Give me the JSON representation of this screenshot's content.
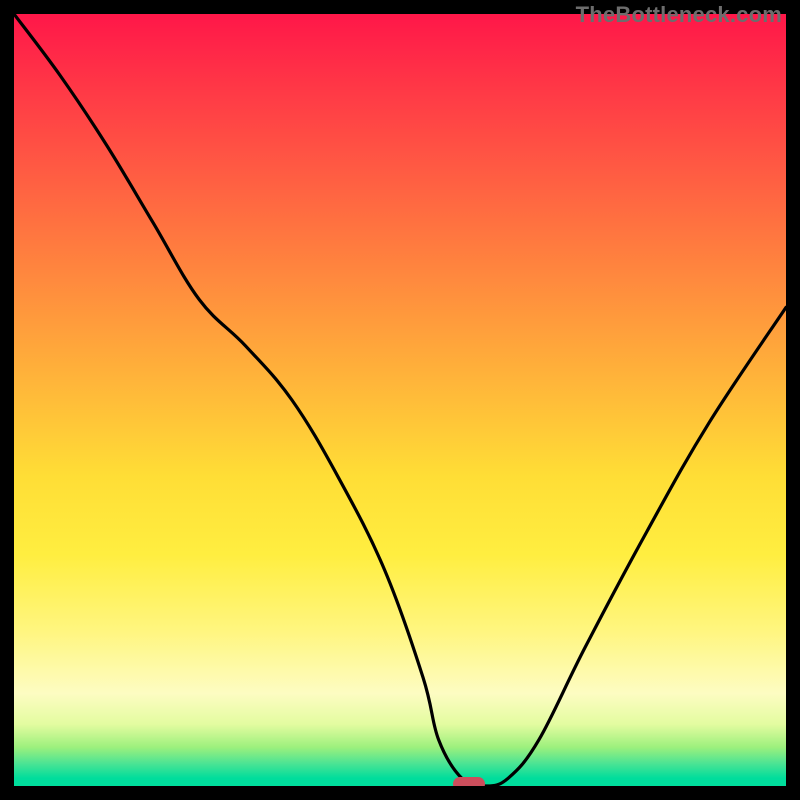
{
  "watermark": "TheBottleneck.com",
  "colors": {
    "border": "#000000",
    "curve": "#000000",
    "marker": "#cc4e5c",
    "gradient_stops": [
      "#ff1749",
      "#ff3946",
      "#ff5a43",
      "#ff7b3f",
      "#ff9c3c",
      "#ffbd39",
      "#ffde36",
      "#ffee40",
      "#fff680",
      "#fdfcc2",
      "#e3fca0",
      "#9cf07d",
      "#4fe493",
      "#00dd9c"
    ]
  },
  "chart_data": {
    "type": "line",
    "title": "",
    "xlabel": "",
    "ylabel": "",
    "xlim": [
      0,
      100
    ],
    "ylim": [
      0,
      100
    ],
    "grid": false,
    "legend": false,
    "series": [
      {
        "name": "bottleneck-curve",
        "x": [
          0,
          6,
          12,
          18,
          24,
          30,
          36,
          42,
          48,
          53,
          55,
          58,
          61,
          64,
          68,
          74,
          82,
          90,
          100
        ],
        "values": [
          100,
          92,
          83,
          73,
          63,
          57,
          50,
          40,
          28,
          14,
          6,
          1,
          0,
          1,
          6,
          18,
          33,
          47,
          62
        ]
      }
    ],
    "marker": {
      "x": 59,
      "y": 0,
      "shape": "rounded-rect"
    },
    "background": "vertical-heat-gradient"
  }
}
